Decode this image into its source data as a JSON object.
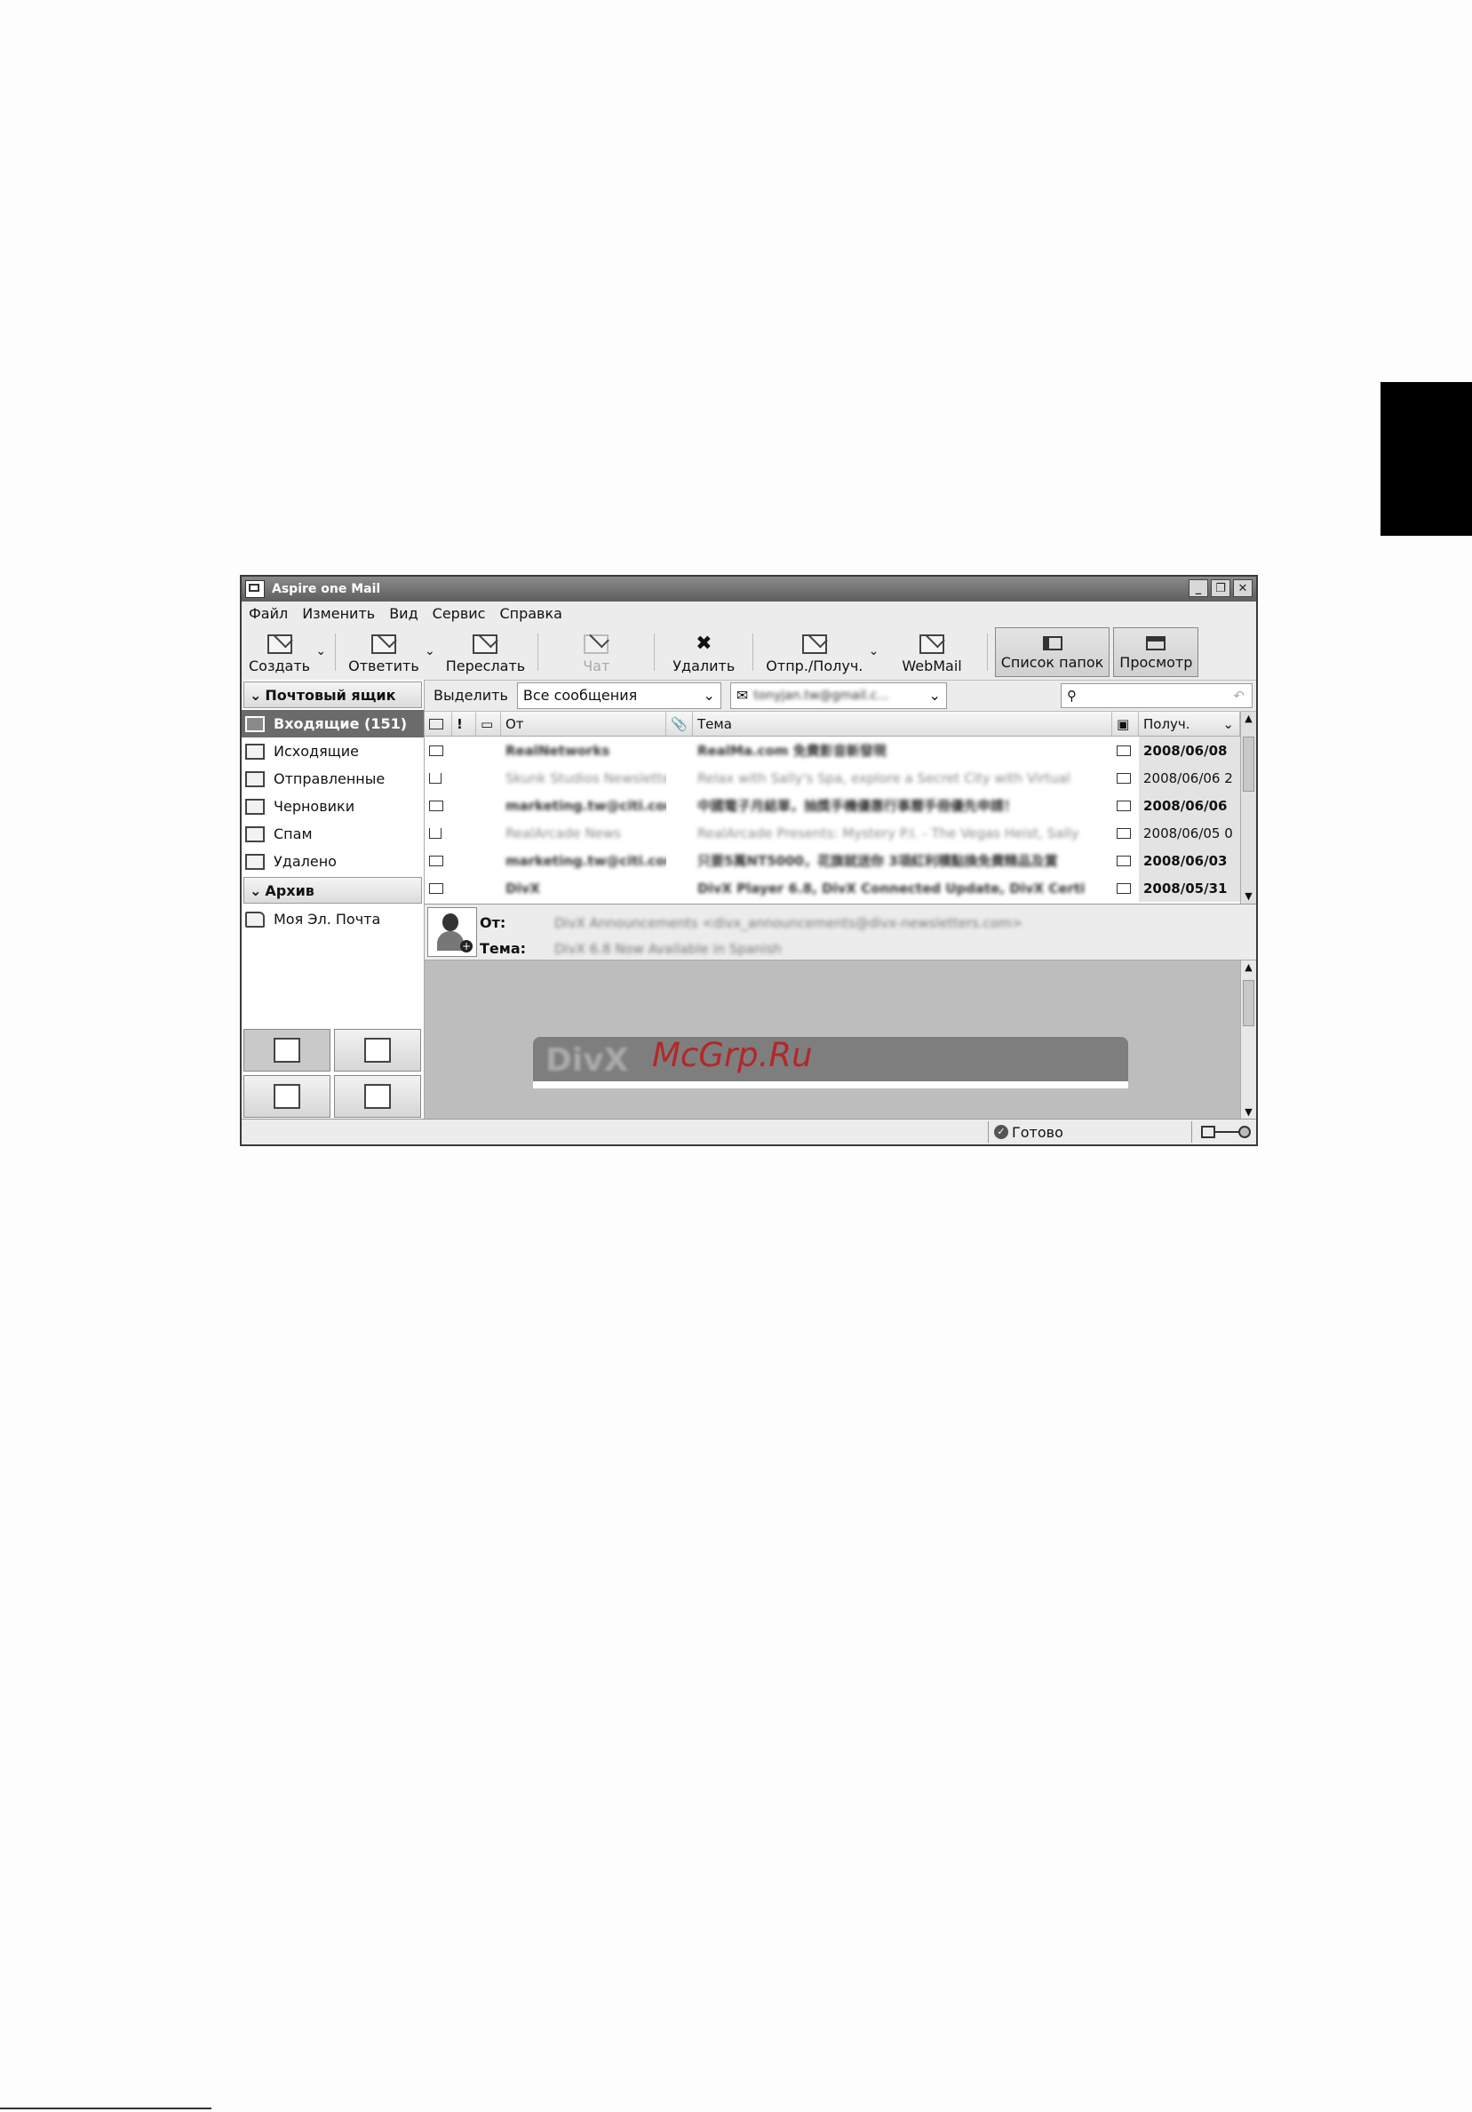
{
  "window": {
    "title": "Aspire one Mail"
  },
  "menu": [
    "Файл",
    "Изменить",
    "Вид",
    "Сервис",
    "Справка"
  ],
  "toolbar": {
    "create": "Создать",
    "reply": "Ответить",
    "forward": "Переслать",
    "chat": "Чат",
    "delete": "Удалить",
    "sendrecv": "Отпр./Получ.",
    "webmail": "WebMail",
    "folders": "Список папок",
    "preview": "Просмотр"
  },
  "sidebar": {
    "mailbox_header": "Почтовый ящик",
    "items": [
      "Входящие (151)",
      "Исходящие",
      "Отправленные",
      "Черновики",
      "Спам",
      "Удалено"
    ],
    "archive_header": "Архив",
    "archive_items": [
      "Моя Эл. Почта"
    ]
  },
  "filter": {
    "select_label": "Выделить",
    "view_value": "Все сообщения",
    "account_value": "tonyjan.tw@gmail.c..."
  },
  "list": {
    "headers": {
      "from": "От",
      "subject": "Тема",
      "received": "Получ."
    },
    "rows": [
      {
        "from": "RealNetworks",
        "subject": "RealMa.com 免費影音新發現",
        "date": "2008/06/08"
      },
      {
        "from": "Skunk Studios Newsletter",
        "subject": "Relax with Sally's Spa, explore a Secret City with Virtual",
        "date": "2008/06/06 2"
      },
      {
        "from": "marketing.tw@citi.com",
        "subject": "中國電子月結單，抽獎手機優惠行事曆手冊優先申請！",
        "date": "2008/06/06"
      },
      {
        "from": "RealArcade News",
        "subject": "RealArcade Presents: Mystery P.I. - The Vegas Heist, Sally",
        "date": "2008/06/05 0"
      },
      {
        "from": "marketing.tw@citi.com",
        "subject": "只要5萬NT5000，花旗就送你 3項紅利積點換免費精品及賞",
        "date": "2008/06/03"
      },
      {
        "from": "DivX",
        "subject": "DivX Player 6.8, DivX Connected Update, DivX Certi",
        "date": "2008/05/31"
      }
    ]
  },
  "preview": {
    "from_label": "От:",
    "from_value": "DivX Announcements <divx_announcements@divx-newsletters.com>",
    "subject_label": "Тема:",
    "subject_value": "DivX 6.8 Now Available in Spanish",
    "banner_text": "DivX"
  },
  "status": {
    "text": "Готово"
  },
  "watermark": "McGrp.Ru"
}
